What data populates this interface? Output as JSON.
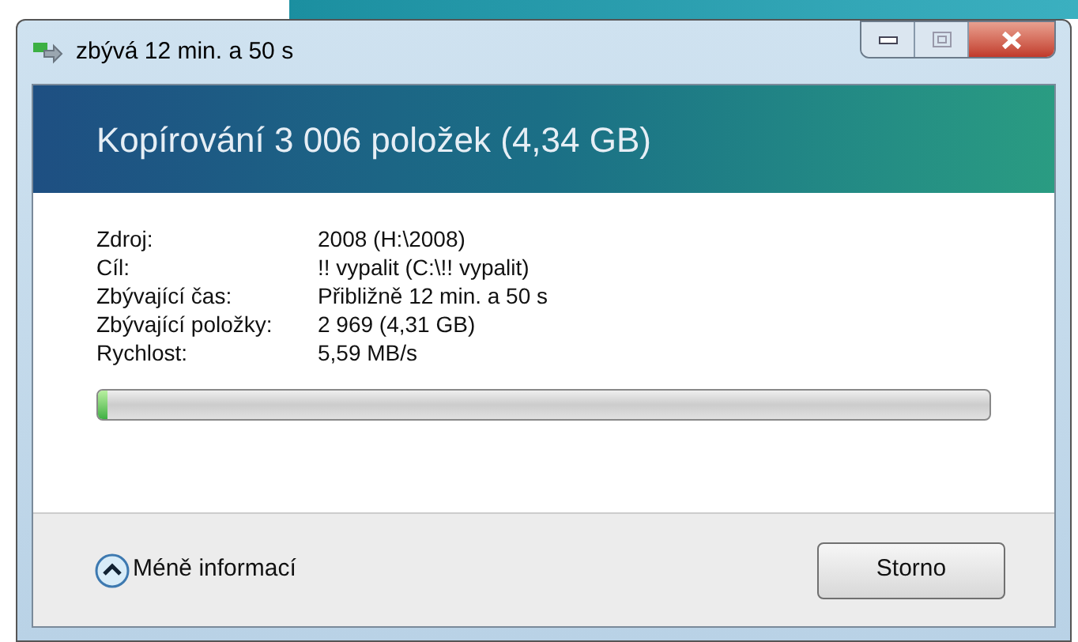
{
  "window": {
    "title": "zbývá 12 min. a 50 s"
  },
  "header": {
    "title": "Kopírování 3 006 položek (4,34 GB)"
  },
  "details": [
    {
      "label": "Zdroj:",
      "value": "2008 (H:\\2008)"
    },
    {
      "label": "Cíl:",
      "value": "!! vypalit (C:\\!! vypalit)"
    },
    {
      "label": "Zbývající čas:",
      "value": "Přibližně 12 min. a 50 s"
    },
    {
      "label": "Zbývající položky:",
      "value": "2 969 (4,31 GB)"
    },
    {
      "label": "Rychlost:",
      "value": "5,59 MB/s"
    }
  ],
  "progress": {
    "level": 0.01
  },
  "footer": {
    "toggle": "Méně informací",
    "cancel": "Storno"
  }
}
